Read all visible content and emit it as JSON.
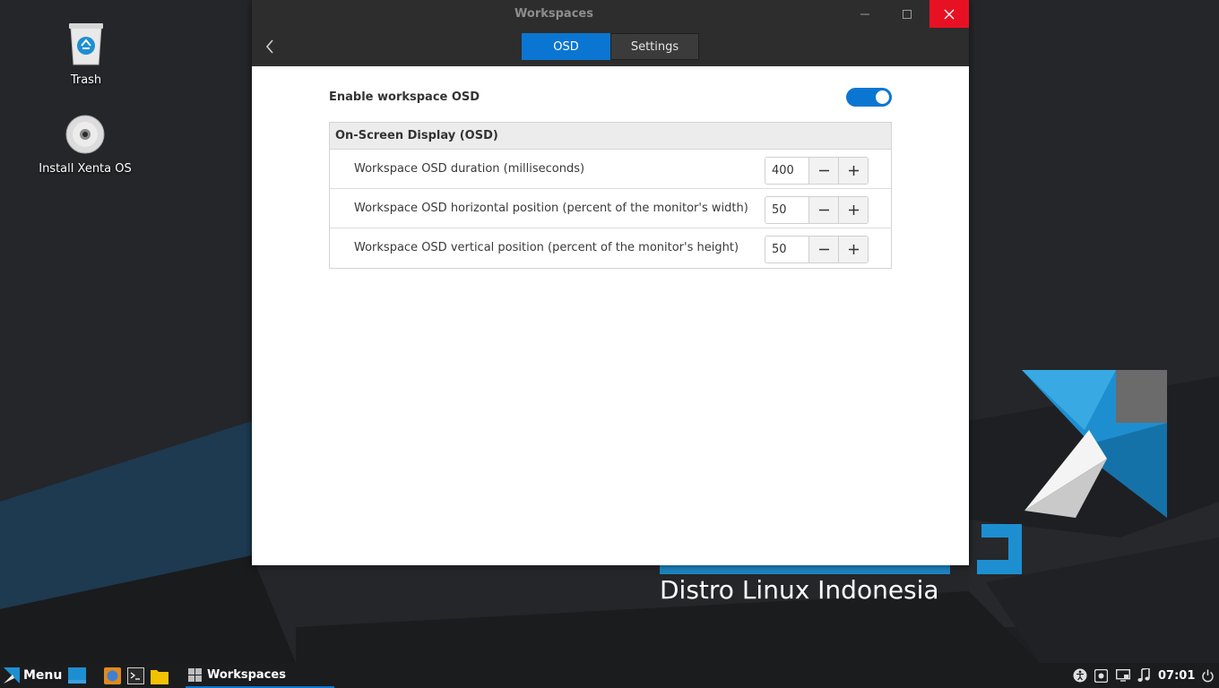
{
  "desktop": {
    "icons": [
      {
        "label": "Trash",
        "icon": "trash-icon"
      },
      {
        "label": "Install Xenta OS",
        "icon": "disc-icon"
      }
    ],
    "wallpaper_tagline": "Distro Linux Indonesia",
    "accent": "#0b76d2"
  },
  "window": {
    "title": "Workspaces",
    "tabs": [
      {
        "label": "OSD",
        "active": true
      },
      {
        "label": "Settings",
        "active": false
      }
    ],
    "enable_label": "Enable workspace OSD",
    "enable_on": true,
    "section": {
      "title": "On-Screen Display (OSD)",
      "rows": [
        {
          "label": "Workspace OSD duration (milliseconds)",
          "value": "400"
        },
        {
          "label": "Workspace OSD horizontal position (percent of the monitor's width)",
          "value": "50"
        },
        {
          "label": "Workspace OSD vertical position (percent of the monitor's height)",
          "value": "50"
        }
      ]
    },
    "close_color": "#e81123"
  },
  "taskbar": {
    "menu_label": "Menu",
    "task_label": "Workspaces",
    "clock": "07:01"
  }
}
